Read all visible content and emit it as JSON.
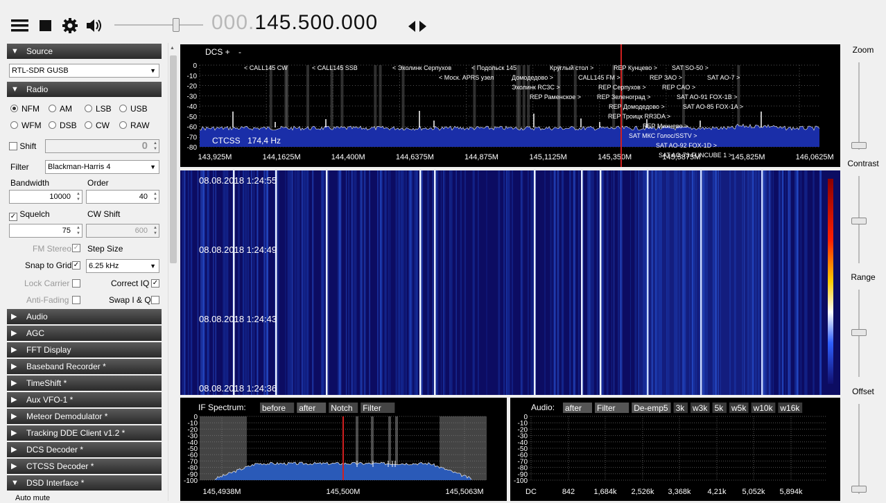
{
  "toolbar": {
    "menu_icon": "hamburger-menu-icon",
    "stop_icon": "stop-icon",
    "settings_icon": "gear-icon",
    "volume_icon": "speaker-icon",
    "freq_dim": "000.",
    "freq_main": "145.500.000",
    "tune_icon": "left-right-arrows-icon"
  },
  "sidebar": {
    "source_header": "Source",
    "source_device": "RTL-SDR GUSB",
    "radio_header": "Radio",
    "modes": [
      "NFM",
      "AM",
      "LSB",
      "USB",
      "WFM",
      "DSB",
      "CW",
      "RAW"
    ],
    "selected_mode": "NFM",
    "shift_label": "Shift",
    "shift_value": "0",
    "filter_label": "Filter",
    "filter_value": "Blackman-Harris 4",
    "bandwidth_label": "Bandwidth",
    "order_label": "Order",
    "bandwidth_value": "10000",
    "order_value": "40",
    "squelch_label": "Squelch",
    "cwshift_label": "CW Shift",
    "squelch_value": "75",
    "cwshift_value": "600",
    "fmstereo_label": "FM Stereo",
    "stepsize_label": "Step Size",
    "snap_label": "Snap to Grid",
    "step_value": "6.25 kHz",
    "lockcarrier_label": "Lock Carrier",
    "correctiq_label": "Correct IQ",
    "antifading_label": "Anti-Fading",
    "swapiq_label": "Swap I & Q",
    "panels": [
      "Audio",
      "AGC",
      "FFT Display",
      "Baseband Recorder *",
      "TimeShift *",
      "Aux VFO-1 *",
      "Meteor Demodulator *",
      "Tracking DDE Client v1.2 *",
      "DCS Decoder *",
      "CTCSS Decoder *",
      "DSD Interface *"
    ],
    "auto_mute": "Auto mute"
  },
  "spectrum": {
    "dcs_label": "DCS +",
    "dcs_minus": "-",
    "ctcss_label": "CTCSS",
    "ctcss_value": "174,4 Hz",
    "y_ticks": [
      "0",
      "-10",
      "-20",
      "-30",
      "-40",
      "-50",
      "-60",
      "-70",
      "-80"
    ],
    "x_ticks": [
      "143,925M",
      "144,1625M",
      "144,400M",
      "144,6375M",
      "144,875M",
      "145,1125M",
      "145,350M",
      "145,5875M",
      "145,825M",
      "146,0625M"
    ],
    "bookmarks": [
      {
        "t": "< CALL145 CW",
        "row": 0,
        "col": 0
      },
      {
        "t": "< CALL145 SSB",
        "row": 0,
        "col": 1
      },
      {
        "t": "< Эхолинк Серпухов",
        "row": 0,
        "col": 2
      },
      {
        "t": "< Подольск 145",
        "row": 0,
        "col": 3
      },
      {
        "t": "Круглый стол >",
        "row": 0,
        "col": 4
      },
      {
        "t": "REP Кунцево >",
        "row": 0,
        "col": 5
      },
      {
        "t": "SAT SO-50 >",
        "row": 0,
        "col": 6
      },
      {
        "t": "< Моск. APRS узел",
        "row": 1,
        "col": 0
      },
      {
        "t": "Домодедово >",
        "row": 1,
        "col": 1
      },
      {
        "t": "CALL145 FM >",
        "row": 1,
        "col": 2
      },
      {
        "t": "REP ЗАО >",
        "row": 1,
        "col": 3
      },
      {
        "t": "SAT AO-7 >",
        "row": 1,
        "col": 4
      },
      {
        "t": "Эхолинк RC3C >",
        "row": 2,
        "col": 0
      },
      {
        "t": "REP Серпухов >",
        "row": 2,
        "col": 1
      },
      {
        "t": "REP CAO >",
        "row": 2,
        "col": 2
      },
      {
        "t": "REP Раменское >",
        "row": 3,
        "col": 0
      },
      {
        "t": "REP Зеленоград >",
        "row": 3,
        "col": 1
      },
      {
        "t": "SAT AO-91 FOX-1B >",
        "row": 3,
        "col": 2
      },
      {
        "t": "REP Домодедово >",
        "row": 4,
        "col": 0
      },
      {
        "t": "SAT AO-85 FOX-1A >",
        "row": 4,
        "col": 1
      },
      {
        "t": "REP Троицк RR3DA >",
        "row": 5,
        "col": 0
      },
      {
        "t": "REP Михнево >",
        "row": 6,
        "col": 0
      },
      {
        "t": "SAT МКС Голос/SSTV >",
        "row": 7,
        "col": 0
      },
      {
        "t": "SAT AO-92 FOX-1D >",
        "row": 8,
        "col": 0
      },
      {
        "t": "SAT AO-73 FUNCUBE 1 >",
        "row": 9,
        "col": 0
      }
    ]
  },
  "waterfall": {
    "timestamps": [
      "08.08.2018 1:24:55",
      "08.08.2018 1:24:49",
      "08.08.2018 1:24:43",
      "08.08.2018 1:24:36"
    ]
  },
  "if_spectrum": {
    "title": "IF Spectrum:",
    "buttons": [
      "before",
      "after",
      "Notch",
      "Filter"
    ],
    "y_ticks": [
      "0",
      "-10",
      "-20",
      "-30",
      "-40",
      "-50",
      "-60",
      "-70",
      "-80",
      "-90",
      "-100"
    ],
    "x_ticks": [
      "145,4938M",
      "145,500M",
      "145,5063M"
    ]
  },
  "audio_spectrum": {
    "title": "Audio:",
    "buttons": [
      "after",
      "Filter",
      "De-emp5",
      "3k",
      "w3k",
      "5k",
      "w5k",
      "w10k",
      "w16k"
    ],
    "y_ticks": [
      "0",
      "-10",
      "-20",
      "-30",
      "-40",
      "-50",
      "-60",
      "-70",
      "-80",
      "-90",
      "-100"
    ],
    "x_ticks": [
      "DC",
      "842",
      "1,684k",
      "2,526k",
      "3,368k",
      "4,21k",
      "5,052k",
      "5,894k"
    ]
  },
  "right_panel": {
    "zoom": "Zoom",
    "contrast": "Contrast",
    "range": "Range",
    "offset": "Offset"
  },
  "colors": {
    "spectrum_fill": "#1a2ea8",
    "waterfall_bg": "#0a0a5a",
    "panel_header": "#3a3a3a",
    "marker": "#d02020"
  }
}
